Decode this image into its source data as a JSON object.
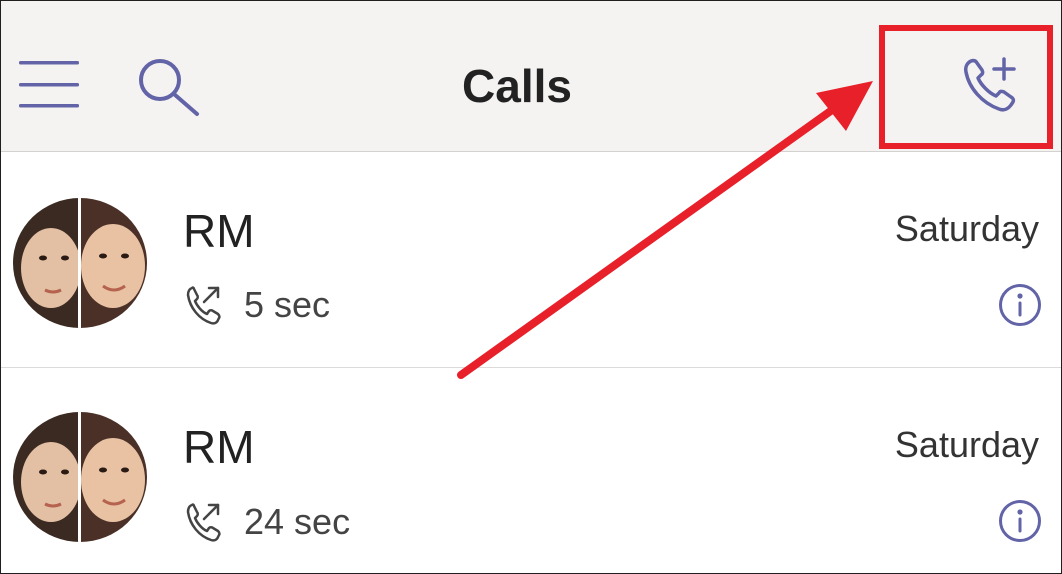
{
  "header": {
    "title": "Calls"
  },
  "calls": [
    {
      "name": "RM",
      "duration": "5 sec",
      "date": "Saturday"
    },
    {
      "name": "RM",
      "duration": "24 sec",
      "date": "Saturday"
    }
  ],
  "colors": {
    "accent": "#6264a7",
    "annotation": "#e8202a"
  },
  "icons": {
    "menu": "hamburger-icon",
    "search": "search-icon",
    "new_call": "phone-plus-icon",
    "outgoing": "outgoing-call-icon",
    "info": "info-icon"
  }
}
